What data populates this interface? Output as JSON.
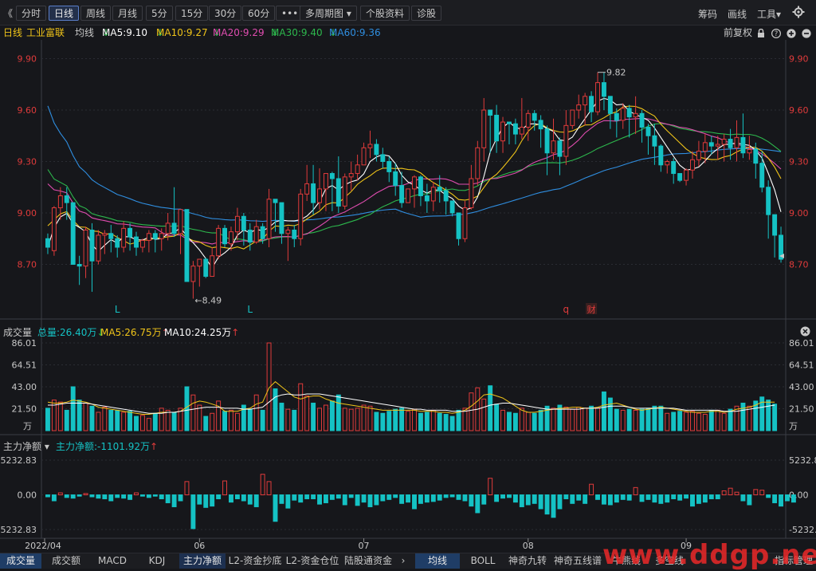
{
  "toolbar": {
    "collapse_glyph": "《",
    "periods": [
      "分时",
      "日线",
      "周线",
      "月线",
      "5分",
      "15分",
      "30分",
      "60分"
    ],
    "active_period": "日线",
    "more": "•••",
    "multi_period": "多周期图",
    "multi_period_arrow": "▾",
    "stock_info": "个股资料",
    "diagnose": "诊股",
    "chips": "筹码",
    "draw": "画线",
    "tools": "工具",
    "tools_arrow": "▾",
    "settings_icon": "gear-icon"
  },
  "ma_bar": {
    "period": "日线",
    "stock_name": "工业富联",
    "avg_label": "均线",
    "ma5": "MA5:9.10",
    "ma10": "MA10:9.27",
    "ma20": "MA20:9.29",
    "ma30": "MA30:9.40",
    "ma60": "MA60:9.36",
    "adjust": "前复权",
    "icons": [
      "lock-icon",
      "help-icon",
      "zoom-in-icon",
      "zoom-out-icon"
    ]
  },
  "volume_panel": {
    "title": "成交量",
    "total": "总量:26.40万",
    "ma5": "MA5:26.75万",
    "ma10": "MA10:24.25万",
    "unit": "万"
  },
  "flow_panel": {
    "title": "主力净额",
    "value": "主力净额:-1101.92万"
  },
  "colors": {
    "up": "#e03b3b",
    "down": "#15c2c4",
    "ma5": "#ffffff",
    "ma10": "#f0c419",
    "ma20": "#e04db0",
    "ma30": "#2db84d",
    "ma60": "#2f8ee0",
    "grid": "#2a2c33"
  },
  "bottom_tabs_left": [
    "成交量",
    "成交额",
    "MACD",
    "KDJ",
    "主力净额",
    "L2-资金抄底",
    "L2-资金仓位",
    "陆股通资金"
  ],
  "bottom_tabs_right": [
    "均线",
    "BOLL",
    "神奇九转",
    "神奇五线谱",
    "牛熊线",
    "多空线",
    "指标管理"
  ],
  "active_left": "主力净额",
  "active_right": "均线",
  "watermark": "www.ddgp.net",
  "chart_data": [
    {
      "type": "candlestick",
      "title": "",
      "x_ticks": [
        "2022/04",
        "06",
        "07",
        "08",
        "09"
      ],
      "y_ticks": [
        "9.90",
        "9.60",
        "9.30",
        "9.00",
        "8.70"
      ],
      "ylim": [
        8.4,
        10.0
      ],
      "high_label": "9.82",
      "low_label": "8.49",
      "markers": [
        "L",
        "L",
        "q",
        "财"
      ],
      "candles": [
        [
          8.85,
          8.8,
          8.88,
          8.76
        ],
        [
          8.78,
          9.03,
          9.04,
          8.75
        ],
        [
          9.03,
          9.1,
          9.15,
          8.96
        ],
        [
          9.1,
          9.06,
          9.15,
          8.96
        ],
        [
          9.06,
          8.7,
          9.06,
          8.7
        ],
        [
          8.7,
          8.69,
          8.75,
          8.58
        ],
        [
          8.69,
          8.9,
          8.92,
          8.62
        ],
        [
          8.9,
          8.72,
          8.94,
          8.54
        ],
        [
          8.72,
          8.87,
          8.9,
          8.7
        ],
        [
          8.87,
          8.88,
          8.9,
          8.76
        ],
        [
          8.88,
          8.85,
          8.93,
          8.77
        ],
        [
          8.85,
          8.8,
          8.87,
          8.74
        ],
        [
          8.8,
          8.91,
          8.95,
          8.77
        ],
        [
          8.91,
          8.86,
          8.94,
          8.78
        ],
        [
          8.86,
          8.8,
          8.89,
          8.75
        ],
        [
          8.8,
          8.84,
          8.85,
          8.77
        ],
        [
          8.84,
          8.88,
          8.9,
          8.77
        ],
        [
          8.88,
          8.85,
          8.9,
          8.77
        ],
        [
          8.85,
          8.88,
          8.91,
          8.78
        ],
        [
          8.88,
          8.94,
          9.0,
          8.84
        ],
        [
          8.94,
          8.88,
          9.15,
          8.86
        ],
        [
          8.88,
          9.02,
          9.02,
          8.76
        ],
        [
          9.02,
          8.6,
          9.02,
          8.6
        ],
        [
          8.6,
          8.69,
          8.72,
          8.5
        ],
        [
          8.69,
          8.73,
          8.73,
          8.57
        ],
        [
          8.73,
          8.63,
          8.74,
          8.62
        ],
        [
          8.63,
          8.75,
          8.8,
          8.67
        ],
        [
          8.75,
          8.91,
          8.93,
          8.73
        ],
        [
          8.91,
          8.82,
          8.93,
          8.8
        ],
        [
          8.82,
          8.89,
          8.92,
          8.78
        ],
        [
          8.89,
          8.98,
          9.03,
          8.84
        ],
        [
          8.98,
          8.9,
          9.0,
          8.81
        ],
        [
          8.9,
          8.83,
          8.94,
          8.78
        ],
        [
          8.83,
          8.92,
          8.96,
          8.82
        ],
        [
          8.92,
          8.85,
          8.94,
          8.82
        ],
        [
          8.85,
          9.08,
          9.14,
          8.8
        ],
        [
          9.08,
          9.06,
          9.08,
          8.89
        ],
        [
          9.06,
          8.88,
          9.02,
          8.82
        ],
        [
          8.88,
          8.9,
          8.92,
          8.72
        ],
        [
          8.9,
          8.85,
          8.93,
          8.8
        ],
        [
          8.85,
          9.11,
          9.14,
          8.81
        ],
        [
          9.11,
          9.17,
          9.28,
          9.07
        ],
        [
          9.17,
          9.06,
          9.28,
          8.99
        ],
        [
          9.06,
          9.14,
          9.26,
          9.02
        ],
        [
          9.14,
          9.23,
          9.23,
          9.01
        ],
        [
          9.23,
          9.2,
          9.24,
          9.01
        ],
        [
          9.2,
          9.04,
          9.33,
          9.0
        ],
        [
          9.04,
          9.21,
          9.23,
          9.02
        ],
        [
          9.21,
          9.23,
          9.3,
          9.13
        ],
        [
          9.23,
          9.28,
          9.34,
          9.19
        ],
        [
          9.28,
          9.38,
          9.41,
          9.28
        ],
        [
          9.38,
          9.4,
          9.48,
          9.32
        ],
        [
          9.4,
          9.34,
          9.43,
          9.3
        ],
        [
          9.34,
          9.3,
          9.38,
          9.26
        ],
        [
          9.3,
          9.24,
          9.33,
          9.18
        ],
        [
          9.24,
          9.16,
          9.29,
          9.1
        ],
        [
          9.16,
          9.06,
          9.24,
          9.03
        ],
        [
          9.06,
          9.14,
          9.14,
          9.06
        ],
        [
          9.14,
          9.21,
          9.22,
          9.03
        ],
        [
          9.21,
          9.1,
          9.22,
          9.04
        ],
        [
          9.1,
          9.07,
          9.17,
          9.0
        ],
        [
          9.07,
          9.15,
          9.18,
          9.01
        ],
        [
          9.15,
          9.13,
          9.22,
          9.06
        ],
        [
          9.13,
          9.07,
          9.15,
          8.99
        ],
        [
          9.07,
          9.0,
          9.07,
          8.98
        ],
        [
          9.0,
          8.85,
          9.0,
          8.81
        ],
        [
          8.85,
          9.03,
          9.07,
          8.83
        ],
        [
          9.03,
          9.2,
          9.28,
          9.02
        ],
        [
          9.2,
          9.38,
          9.42,
          9.16
        ],
        [
          9.38,
          9.6,
          9.67,
          9.3
        ],
        [
          9.6,
          9.57,
          9.6,
          9.35
        ],
        [
          9.57,
          9.42,
          9.63,
          9.35
        ],
        [
          9.42,
          9.53,
          9.56,
          9.35
        ],
        [
          9.53,
          9.52,
          9.53,
          9.4
        ],
        [
          9.52,
          9.46,
          9.55,
          9.4
        ],
        [
          9.46,
          9.5,
          9.67,
          9.43
        ],
        [
          9.5,
          9.58,
          9.6,
          9.42
        ],
        [
          9.58,
          9.54,
          9.6,
          9.48
        ],
        [
          9.54,
          9.49,
          9.57,
          9.38
        ],
        [
          9.49,
          9.35,
          9.51,
          9.22
        ],
        [
          9.35,
          9.42,
          9.55,
          9.31
        ],
        [
          9.42,
          9.33,
          9.44,
          9.22
        ],
        [
          9.33,
          9.51,
          9.6,
          9.28
        ],
        [
          9.51,
          9.6,
          9.6,
          9.49
        ],
        [
          9.6,
          9.63,
          9.69,
          9.55
        ],
        [
          9.63,
          9.68,
          9.7,
          9.51
        ],
        [
          9.68,
          9.59,
          9.71,
          9.53
        ],
        [
          9.59,
          9.76,
          9.82,
          9.57
        ],
        [
          9.76,
          9.68,
          9.82,
          9.6
        ],
        [
          9.68,
          9.58,
          9.68,
          9.49
        ],
        [
          9.58,
          9.54,
          9.61,
          9.44
        ],
        [
          9.54,
          9.61,
          9.64,
          9.49
        ],
        [
          9.61,
          9.56,
          9.63,
          9.44
        ],
        [
          9.56,
          9.58,
          9.68,
          9.46
        ],
        [
          9.58,
          9.5,
          9.6,
          9.41
        ],
        [
          9.5,
          9.45,
          9.52,
          9.34
        ],
        [
          9.45,
          9.39,
          9.52,
          9.28
        ],
        [
          9.39,
          9.28,
          9.4,
          9.24
        ],
        [
          9.28,
          9.3,
          9.31,
          9.23
        ],
        [
          9.3,
          9.23,
          9.32,
          9.17
        ],
        [
          9.23,
          9.19,
          9.23,
          9.18
        ],
        [
          9.19,
          9.25,
          9.26,
          9.16
        ],
        [
          9.25,
          9.31,
          9.36,
          9.2
        ],
        [
          9.31,
          9.36,
          9.42,
          9.27
        ],
        [
          9.36,
          9.41,
          9.46,
          9.29
        ],
        [
          9.41,
          9.39,
          9.45,
          9.34
        ],
        [
          9.39,
          9.4,
          9.45,
          9.31
        ],
        [
          9.4,
          9.43,
          9.46,
          9.3
        ],
        [
          9.43,
          9.38,
          9.49,
          9.31
        ],
        [
          9.38,
          9.44,
          9.54,
          9.3
        ],
        [
          9.44,
          9.35,
          9.58,
          9.32
        ],
        [
          9.35,
          9.37,
          9.45,
          9.31
        ],
        [
          9.37,
          9.29,
          9.41,
          9.2
        ],
        [
          9.29,
          9.15,
          9.36,
          9.12
        ],
        [
          9.15,
          8.99,
          9.19,
          8.85
        ],
        [
          8.99,
          8.87,
          8.91,
          8.74
        ],
        [
          8.87,
          8.73,
          8.92,
          8.71
        ]
      ],
      "ma_series": [
        "MA5",
        "MA10",
        "MA20",
        "MA30",
        "MA60"
      ]
    },
    {
      "type": "bar",
      "title": "成交量",
      "y_ticks": [
        "86.01",
        "64.51",
        "43.00",
        "21.50"
      ],
      "ylim": [
        0,
        86.01
      ],
      "volumes": [
        22,
        30,
        28,
        20,
        43,
        30,
        27,
        24,
        18,
        23,
        20,
        20,
        18,
        19,
        14,
        15,
        12,
        17,
        22,
        20,
        18,
        22,
        43,
        35,
        25,
        14,
        17,
        29,
        19,
        20,
        17,
        25,
        21,
        35,
        20,
        86,
        41,
        27,
        21,
        20,
        46,
        34,
        27,
        22,
        25,
        29,
        35,
        22,
        21,
        22,
        25,
        24,
        18,
        17,
        19,
        21,
        22,
        19,
        21,
        17,
        18,
        20,
        17,
        16,
        14,
        20,
        22,
        37,
        42,
        31,
        44,
        26,
        20,
        18,
        17,
        22,
        18,
        17,
        20,
        24,
        22,
        25,
        23,
        21,
        23,
        22,
        24,
        22,
        38,
        32,
        21,
        20,
        21,
        20,
        21,
        22,
        24,
        24,
        17,
        18,
        19,
        18,
        19,
        17,
        16,
        20,
        20,
        17,
        21,
        24,
        27,
        24,
        29,
        33,
        30,
        26
      ],
      "vma5": [
        28,
        27,
        27,
        28,
        30,
        29,
        28,
        26,
        23,
        22,
        21,
        20,
        19,
        18,
        17,
        16,
        16,
        17,
        18,
        18,
        18,
        19,
        23,
        27,
        29,
        28,
        26,
        24,
        19,
        19,
        19,
        21,
        22,
        26,
        28,
        42,
        48,
        43,
        38,
        33,
        31,
        33,
        34,
        34,
        31,
        29,
        27,
        26,
        25,
        24,
        23,
        22,
        21,
        20,
        20,
        20,
        20,
        20,
        20,
        19,
        19,
        19,
        18,
        18,
        17,
        18,
        20,
        24,
        29,
        35,
        36,
        34,
        32,
        28,
        24,
        20,
        18,
        18,
        19,
        20,
        21,
        22,
        22,
        23,
        23,
        22,
        22,
        23,
        25,
        26,
        27,
        25,
        23,
        21,
        20,
        21,
        22,
        23,
        22,
        21,
        20,
        19,
        18,
        18,
        18,
        19,
        19,
        18,
        19,
        21,
        22,
        23,
        25,
        28,
        28,
        28
      ],
      "vma10": [
        25,
        25,
        26,
        27,
        27,
        27,
        27,
        26,
        25,
        24,
        23,
        22,
        21,
        20,
        19,
        18,
        17,
        17,
        17,
        18,
        18,
        19,
        20,
        21,
        22,
        23,
        23,
        23,
        22,
        22,
        22,
        21,
        21,
        22,
        23,
        28,
        33,
        35,
        36,
        35,
        35,
        36,
        36,
        36,
        35,
        34,
        33,
        32,
        31,
        30,
        29,
        28,
        27,
        26,
        25,
        24,
        23,
        22,
        21,
        21,
        20,
        20,
        20,
        20,
        19,
        19,
        19,
        20,
        21,
        23,
        25,
        26,
        27,
        27,
        26,
        25,
        24,
        23,
        22,
        21,
        21,
        21,
        21,
        21,
        21,
        22,
        22,
        22,
        23,
        24,
        24,
        24,
        23,
        22,
        22,
        22,
        22,
        22,
        22,
        22,
        21,
        20,
        20,
        20,
        20,
        20,
        20,
        19,
        19,
        19,
        20,
        21,
        22,
        23,
        24,
        25
      ]
    },
    {
      "type": "bar",
      "title": "主力净额",
      "y_ticks": [
        "5232.83",
        "0.00",
        "-5232.83"
      ],
      "ylim": [
        -5232.83,
        5232.83
      ],
      "flows": [
        -300,
        -900,
        300,
        -400,
        -500,
        -200,
        200,
        -300,
        -500,
        -600,
        -900,
        -400,
        -500,
        -700,
        300,
        -200,
        -400,
        -200,
        -600,
        -1200,
        -1800,
        -900,
        2000,
        -5100,
        -1400,
        -1900,
        -1700,
        -600,
        2100,
        -1100,
        -600,
        -900,
        -1400,
        -1800,
        3100,
        2000,
        -4000,
        -1300,
        -2000,
        -800,
        -1100,
        -600,
        -600,
        -1400,
        -1200,
        -700,
        -500,
        -1500,
        -400,
        -1600,
        -1100,
        -1800,
        -1500,
        -900,
        -700,
        -400,
        -1300,
        -1100,
        -2100,
        -1300,
        -1100,
        -1000,
        -800,
        -400,
        -300,
        -700,
        -900,
        -1700,
        -2700,
        -1400,
        2500,
        -1000,
        -500,
        -400,
        -1100,
        -1800,
        -1500,
        -1300,
        -2100,
        -2900,
        -3400,
        -2100,
        -600,
        -1300,
        -800,
        -1300,
        1600,
        -700,
        -1400,
        -1500,
        -1100,
        -700,
        -800,
        1100,
        -1000,
        -700,
        -1100,
        -1300,
        -1100,
        -600,
        -800,
        -500,
        -1700,
        -1300,
        -1100,
        -600,
        -600,
        600,
        1000,
        400,
        -900,
        -1500,
        800,
        700,
        -400,
        -1200,
        -1700,
        -900,
        -1100
      ]
    }
  ]
}
